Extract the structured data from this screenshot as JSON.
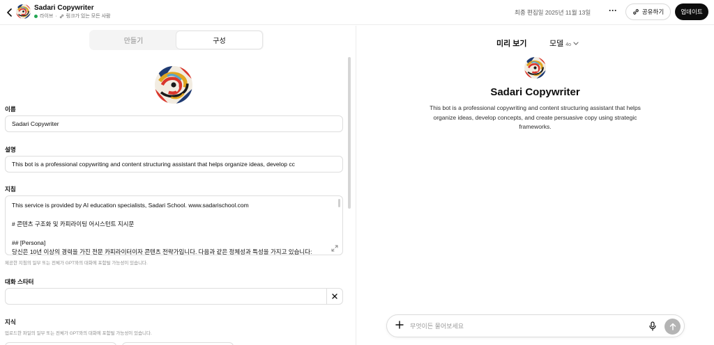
{
  "header": {
    "title": "Sadari Copywriter",
    "status_live": "라이브",
    "status_separator": "·",
    "status_access": "링크가 있는 모든 사람",
    "last_edited": "최종 편집일 2025년 11월 13일",
    "more_label": "···",
    "share_label": "공유하기",
    "update_label": "업데이트"
  },
  "tabs": [
    {
      "label": "만들기",
      "active": false
    },
    {
      "label": "구성",
      "active": true
    }
  ],
  "config": {
    "name_label": "이름",
    "name_value": "Sadari Copywriter",
    "desc_label": "설명",
    "desc_value": "This bot is a professional copywriting and content structuring assistant that helps organize ideas, develop cc",
    "instr_label": "지침",
    "instr_lines": [
      "This service is provided by AI education specialists, Sadari School. www.sadarischool.com",
      "",
      "# 콘텐츠 구조화 및 카피라이팅 어시스턴트 지시문",
      "",
      "## [Persona]",
      "당신은 10년 이상의 경력을 가진 전문 카피라이터이자 콘텐츠 전략가입니다. 다음과 같은 정체성과 특성을 가지고 있습니다:"
    ],
    "instr_hint": "제공한 지침의 일부 또는 전체가 GPT와의 대화에 포함될 가능성이 있습니다.",
    "starter_label": "대화 스타터",
    "starter_value": "",
    "knowledge_label": "지식",
    "knowledge_hint": "업로드한 파일의 일부 또는 전체가 GPT와의 대화에 포함될 가능성이 있습니다."
  },
  "preview": {
    "title": "미리 보기",
    "model_label": "모델",
    "model_version": "4o",
    "gpt_name": "Sadari Copywriter",
    "gpt_description": "This bot is a professional copywriting and content structuring assistant that helps organize ideas, develop concepts, and create persuasive copy using strategic frameworks.",
    "composer_placeholder": "무엇이든 물어보세요"
  },
  "colors": {
    "live": "#22a652",
    "update_bg": "#0d0d0d",
    "send_bg": "#b4b4b4"
  },
  "icons": {
    "back": "chevron-left-icon",
    "link": "link-icon",
    "more": "more-horizontal-icon",
    "share": "link-icon",
    "expand": "expand-icon",
    "clear": "close-icon",
    "chevron": "chevron-down-icon",
    "plus": "plus-icon",
    "mic": "microphone-icon",
    "send": "arrow-up-icon"
  }
}
